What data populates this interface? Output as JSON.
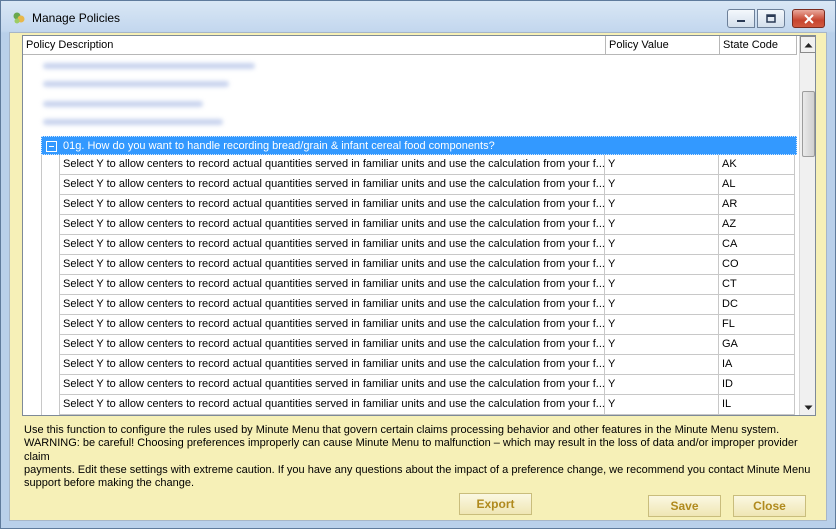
{
  "window": {
    "title": "Manage Policies",
    "icons": {
      "app": "policy-app-icon",
      "minimize": "minimize-icon",
      "maximize": "maximize-icon",
      "close": "close-x-icon"
    }
  },
  "grid": {
    "columns": [
      "Policy Description",
      "Policy Value",
      "State Code"
    ],
    "group": {
      "label": "01g. How do you want to handle recording bread/grain & infant cereal food components?",
      "expanded": true
    },
    "rows": [
      {
        "description": "Select Y to allow centers to record actual quantities served in familiar units and use the calculation from your f...",
        "value": "Y",
        "state": "AK"
      },
      {
        "description": "Select Y to allow centers to record actual quantities served in familiar units and use the calculation from your f...",
        "value": "Y",
        "state": "AL"
      },
      {
        "description": "Select Y to allow centers to record actual quantities served in familiar units and use the calculation from your f...",
        "value": "Y",
        "state": "AR"
      },
      {
        "description": "Select Y to allow centers to record actual quantities served in familiar units and use the calculation from your f...",
        "value": "Y",
        "state": "AZ"
      },
      {
        "description": "Select Y to allow centers to record actual quantities served in familiar units and use the calculation from your f...",
        "value": "Y",
        "state": "CA"
      },
      {
        "description": "Select Y to allow centers to record actual quantities served in familiar units and use the calculation from your f...",
        "value": "Y",
        "state": "CO"
      },
      {
        "description": "Select Y to allow centers to record actual quantities served in familiar units and use the calculation from your f...",
        "value": "Y",
        "state": "CT"
      },
      {
        "description": "Select Y to allow centers to record actual quantities served in familiar units and use the calculation from your f...",
        "value": "Y",
        "state": "DC"
      },
      {
        "description": "Select Y to allow centers to record actual quantities served in familiar units and use the calculation from your f...",
        "value": "Y",
        "state": "FL"
      },
      {
        "description": "Select Y to allow centers to record actual quantities served in familiar units and use the calculation from your f...",
        "value": "Y",
        "state": "GA"
      },
      {
        "description": "Select Y to allow centers to record actual quantities served in familiar units and use the calculation from your f...",
        "value": "Y",
        "state": "IA"
      },
      {
        "description": "Select Y to allow centers to record actual quantities served in familiar units and use the calculation from your f...",
        "value": "Y",
        "state": "ID"
      },
      {
        "description": "Select Y to allow centers to record actual quantities served in familiar units and use the calculation from your f...",
        "value": "Y",
        "state": "IL"
      }
    ]
  },
  "info": {
    "lines": [
      "Use this function to configure the rules used by Minute Menu that govern certain claims processing behavior and other features in the Minute Menu system.",
      "WARNING:  be careful!  Choosing preferences improperly can cause Minute Menu to malfunction – which may result in the loss of data and/or improper provider claim",
      "payments.  Edit these settings with extreme caution.  If you have any questions about the impact of a preference change, we recommend you contact Minute Menu",
      "support before making the change."
    ]
  },
  "buttons": {
    "export": "Export",
    "save": "Save",
    "close": "Close"
  },
  "colors": {
    "selection": "#3399ff",
    "panel": "#f6f0b7",
    "button_text": "#b08a1e"
  }
}
